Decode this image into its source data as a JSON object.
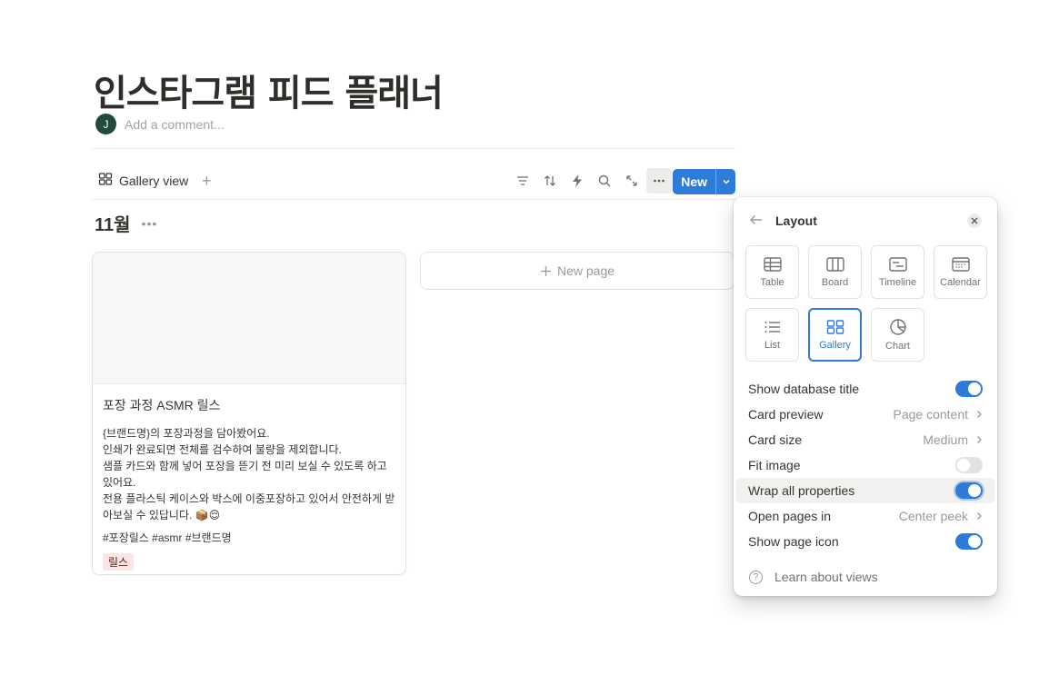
{
  "page": {
    "title": "인스타그램 피드 플래너",
    "avatar_initial": "J",
    "comment_placeholder": "Add a comment..."
  },
  "toolbar": {
    "view_label": "Gallery view",
    "add_view": "+",
    "icons": [
      "filter-icon",
      "sort-icon",
      "automation-icon",
      "search-icon",
      "expand-icon",
      "more-icon"
    ],
    "new_label": "New"
  },
  "group": {
    "title": "11월",
    "more": "•••"
  },
  "card": {
    "title": "포장 과정 ASMR 릴스",
    "description_lines": [
      "{브랜드명}의 포장과정을 담아봤어요.",
      "인쇄가 완료되면 전체를 검수하여 불량을 제외합니다.",
      "샘플 카드와 함께 넣어 포장을 뜯기 전 미리 보실 수 있도록 하고 있어요.",
      "전용 플라스틱 케이스와 박스에 이중포장하고 있어서 안전하게 받아보실 수 있답니다. 📦😌"
    ],
    "hashtags": "#포장릴스 #asmr #브랜드명",
    "tag": "릴스",
    "tag_color": "#fbe4e4"
  },
  "new_page_label": "New page",
  "layout_panel": {
    "title": "Layout",
    "options": [
      {
        "label": "Table",
        "icon": "table-icon",
        "selected": false
      },
      {
        "label": "Board",
        "icon": "board-icon",
        "selected": false
      },
      {
        "label": "Timeline",
        "icon": "timeline-icon",
        "selected": false
      },
      {
        "label": "Calendar",
        "icon": "calendar-icon",
        "selected": false
      },
      {
        "label": "List",
        "icon": "list-icon",
        "selected": false
      },
      {
        "label": "Gallery",
        "icon": "gallery-icon",
        "selected": true
      },
      {
        "label": "Chart",
        "icon": "chart-icon",
        "selected": false
      }
    ],
    "settings": [
      {
        "label": "Show database title",
        "type": "toggle",
        "on": true
      },
      {
        "label": "Card preview",
        "type": "select",
        "value": "Page content"
      },
      {
        "label": "Card size",
        "type": "select",
        "value": "Medium"
      },
      {
        "label": "Fit image",
        "type": "toggle",
        "on": false
      },
      {
        "label": "Wrap all properties",
        "type": "toggle",
        "on": true
      },
      {
        "label": "Open pages in",
        "type": "select",
        "value": "Center peek"
      },
      {
        "label": "Show page icon",
        "type": "toggle",
        "on": true
      }
    ],
    "learn_label": "Learn about views"
  },
  "colors": {
    "accent": "#2f7bd9",
    "text": "#37352f",
    "muted": "#9b9a97"
  }
}
